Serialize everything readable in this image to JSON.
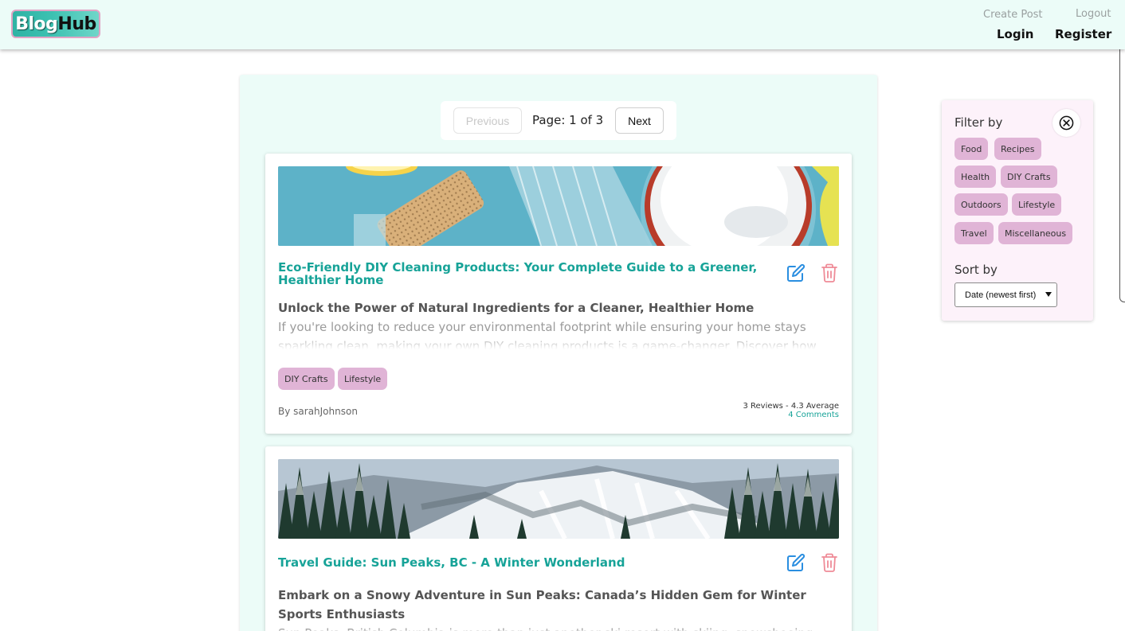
{
  "nav": {
    "logo_part1": "Blog",
    "logo_part2": "Hub",
    "create_post": "Create Post",
    "logout": "Logout",
    "login": "Login",
    "register": "Register"
  },
  "pagination": {
    "previous": "Previous",
    "page_label": "Page: 1 of 3",
    "next": "Next"
  },
  "posts": [
    {
      "title": "Eco-Friendly DIY Cleaning Products: Your Complete Guide to a Greener, Healthier Home",
      "subtitle": "Unlock the Power of Natural Ingredients for a Cleaner, Healthier Home",
      "excerpt": "If you're looking to reduce your environmental footprint while ensuring your home stays sparkling clean, making your own DIY cleaning products is a game-changer. Discover how simple",
      "tags": [
        "DIY Crafts",
        "Lifestyle"
      ],
      "author": "By sarahJohnson",
      "reviews": "3 Reviews - 4.3 Average",
      "comments": "4 Comments"
    },
    {
      "title": "Travel Guide: Sun Peaks, BC - A Winter Wonderland",
      "subtitle": "Embark on a Snowy Adventure in Sun Peaks: Canada’s Hidden Gem for Winter Sports Enthusiasts",
      "excerpt": "Sun Peaks, British Columbia is more than just another ski resort with skiing, snowshoeing and"
    }
  ],
  "filter": {
    "title": "Filter by",
    "categories": [
      "Food",
      "Recipes",
      "Health",
      "DIY Crafts",
      "Outdoors",
      "Lifestyle",
      "Travel",
      "Miscellaneous"
    ],
    "sort_title": "Sort by",
    "sort_selected": "Date (newest first)"
  },
  "colors": {
    "accent": "#17a398",
    "tag_bg": "#e0b4d6",
    "nav_bg": "#ecfcf8",
    "edit_icon": "#2a8ee0",
    "delete_icon": "#ef8b97"
  }
}
